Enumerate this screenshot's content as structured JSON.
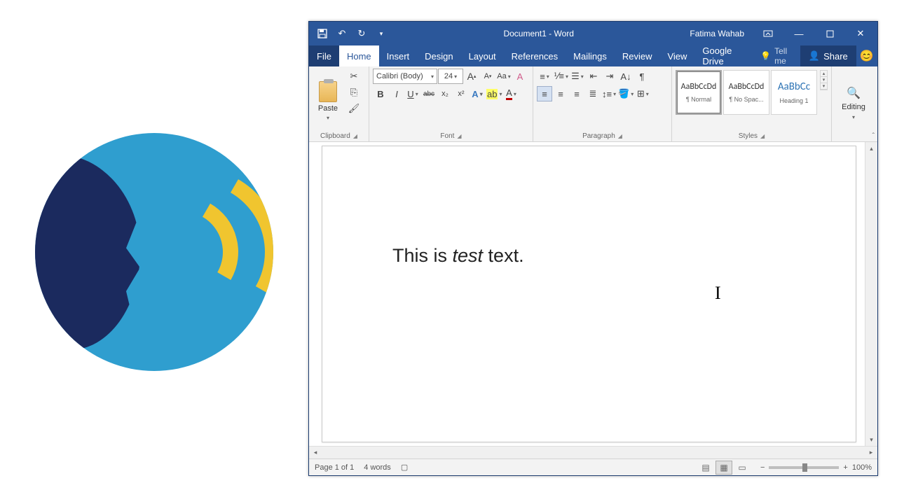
{
  "titlebar": {
    "doc_title": "Document1 - Word",
    "user": "Fatima Wahab"
  },
  "tabs": {
    "file": "File",
    "items": [
      "Home",
      "Insert",
      "Design",
      "Layout",
      "References",
      "Mailings",
      "Review",
      "View",
      "Google Drive"
    ],
    "active": "Home",
    "tellme": "Tell me",
    "share": "Share"
  },
  "ribbon": {
    "clipboard": {
      "label": "Clipboard",
      "paste": "Paste"
    },
    "font": {
      "label": "Font",
      "name": "Calibri (Body)",
      "size": "24",
      "bold": "B",
      "italic": "I",
      "underline": "U",
      "strike": "abc",
      "sub": "x₂",
      "sup": "x²",
      "grow": "A",
      "shrink": "A",
      "case": "Aa",
      "clear": "A"
    },
    "paragraph": {
      "label": "Paragraph"
    },
    "styles": {
      "label": "Styles",
      "items": [
        {
          "preview": "AaBbCcDd",
          "name": "¶ Normal"
        },
        {
          "preview": "AaBbCcDd",
          "name": "¶ No Spac..."
        },
        {
          "preview": "AaBbCc",
          "name": "Heading 1"
        }
      ]
    },
    "editing": {
      "label": "Editing"
    }
  },
  "document": {
    "line_before": "This is ",
    "line_italic": "test",
    "line_after": " text."
  },
  "statusbar": {
    "page": "Page 1 of 1",
    "words": "4 words",
    "zoom": "100%"
  }
}
